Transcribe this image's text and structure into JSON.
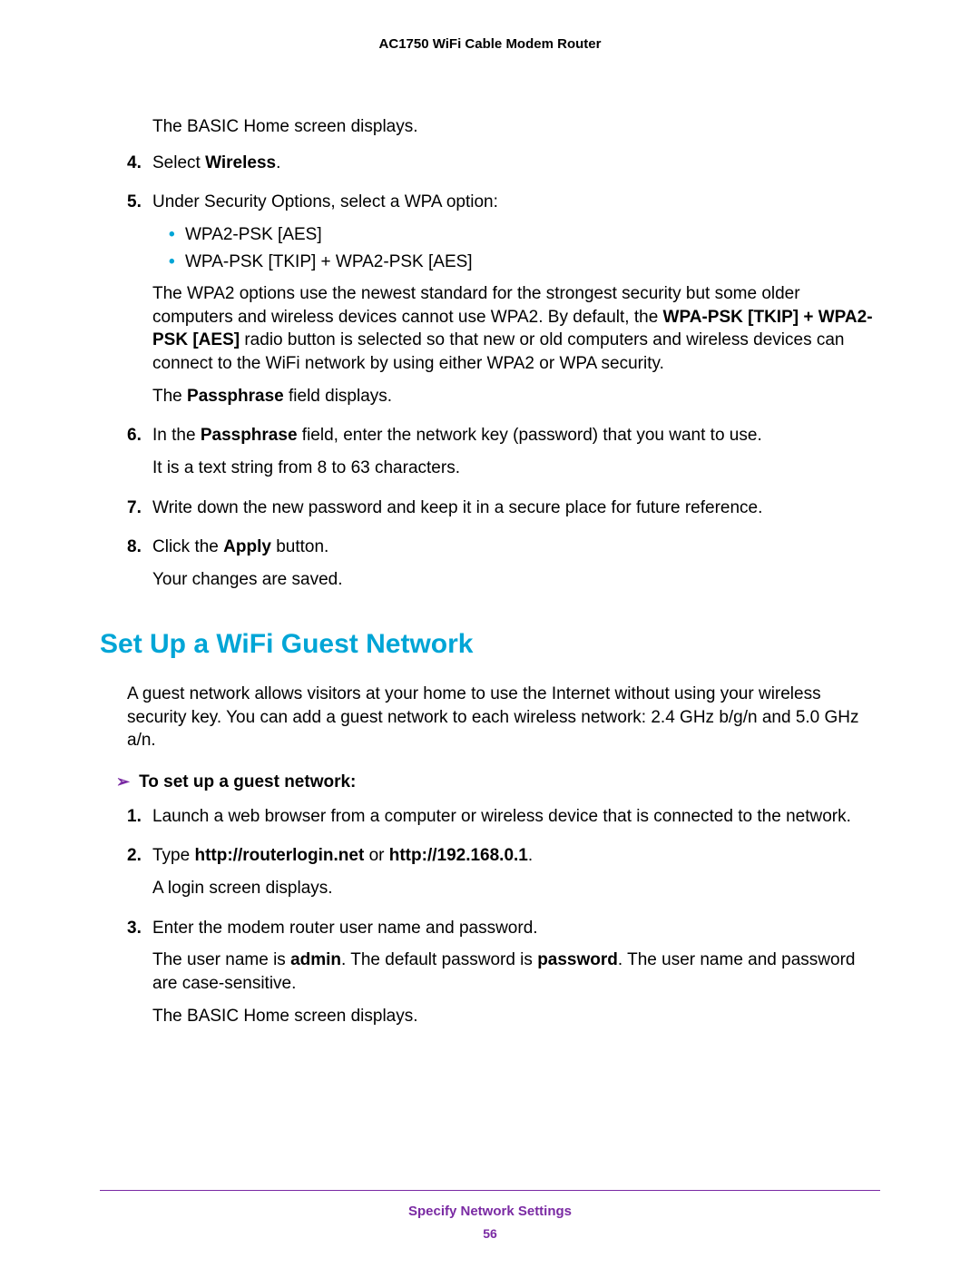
{
  "header": {
    "title": "AC1750 WiFi Cable Modem Router"
  },
  "top_text": "The BASIC Home screen displays.",
  "steps1": {
    "s4_num": "4.",
    "s4_a": "Select ",
    "s4_b": "Wireless",
    "s4_c": ".",
    "s5_num": "5.",
    "s5_lead": "Under Security Options, select a WPA option:",
    "s5_bullets": [
      "WPA2-PSK [AES]",
      "WPA-PSK [TKIP] + WPA2-PSK [AES]"
    ],
    "s5_para_a": "The WPA2 options use the newest standard for the strongest security but some older computers and wireless devices cannot use WPA2. By default, the ",
    "s5_para_b": "WPA-PSK [TKIP] + WPA2-PSK [AES]",
    "s5_para_c": " radio button is selected so that new or old computers and wireless devices can connect to the WiFi network by using either WPA2 or WPA security.",
    "s5_para2_a": "The ",
    "s5_para2_b": "Passphrase",
    "s5_para2_c": " field displays.",
    "s6_num": "6.",
    "s6_a": "In the ",
    "s6_b": "Passphrase",
    "s6_c": " field, enter the network key (password) that you want to use.",
    "s6_para": "It is a text string from 8 to 63 characters.",
    "s7_num": "7.",
    "s7_text": "Write down the new password and keep it in a secure place for future reference.",
    "s8_num": "8.",
    "s8_a": "Click the ",
    "s8_b": "Apply",
    "s8_c": " button.",
    "s8_para": "Your changes are saved."
  },
  "section_heading": "Set Up a WiFi Guest Network",
  "section_intro": "A guest network allows visitors at your home to use the Internet without using your wireless security key. You can add a guest network to each wireless network: 2.4 GHz b/g/n and 5.0 GHz a/n.",
  "task_arrow": "➢",
  "task_label": "To set up a guest network:",
  "steps2": {
    "s1_num": "1.",
    "s1_text": "Launch a web browser from a computer or wireless device that is connected to the network.",
    "s2_num": "2.",
    "s2_a": "Type ",
    "s2_b": "http://routerlogin.net",
    "s2_c": " or ",
    "s2_d": "http://192.168.0.1",
    "s2_e": ".",
    "s2_para": "A login screen displays.",
    "s3_num": "3.",
    "s3_text": "Enter the modem router user name and password.",
    "s3_para_a": "The user name is ",
    "s3_para_b": "admin",
    "s3_para_c": ". The default password is ",
    "s3_para_d": "password",
    "s3_para_e": ". The user name and password are case-sensitive.",
    "s3_para2": "The BASIC Home screen displays."
  },
  "footer": {
    "chapter": "Specify Network Settings",
    "page": "56"
  }
}
